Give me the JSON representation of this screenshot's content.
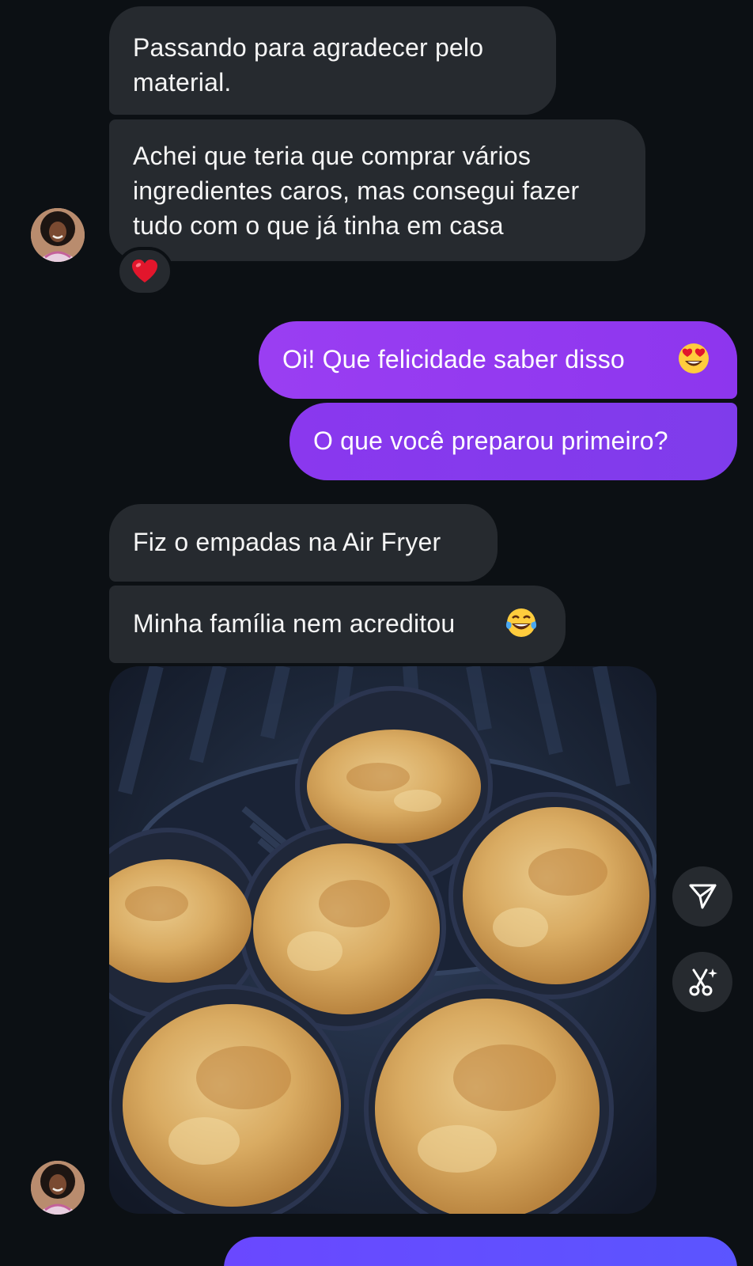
{
  "messages": {
    "m1": "Passando para agradecer pelo material.",
    "m2": "Achei que teria que comprar vários ingredientes caros, mas consegui fazer tudo com o que já tinha em casa",
    "m3": "Oi! Que felicidade saber disso",
    "m4": "O que você preparou primeiro?",
    "m5": "Fiz o empadas na Air Fryer",
    "m6": "Minha família nem acreditou"
  },
  "reaction": {
    "emoji": "heart-emoji"
  },
  "image": {
    "description_name": "empadas-air-fryer-photo"
  },
  "icons": {
    "share": "paper-plane-icon",
    "remix": "scissors-sparkle-icon",
    "emoji_heart_eyes": "heart-eyes-emoji",
    "emoji_laugh": "tears-of-joy-emoji"
  },
  "colors": {
    "background": "#0c1014",
    "incoming_bubble": "#262a2f",
    "outgoing_start": "#a033f0",
    "outgoing_end": "#7c3aed",
    "outgoing_bottom": "#6d4aff"
  }
}
